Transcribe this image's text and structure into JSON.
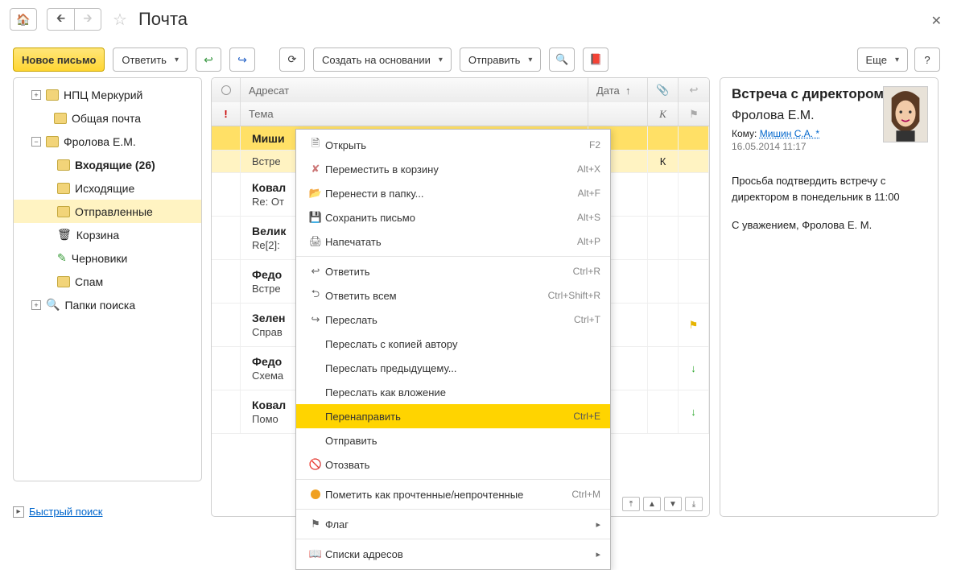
{
  "titlebar": {
    "title": "Почта"
  },
  "toolbar": {
    "new_mail": "Новое письмо",
    "reply": "Ответить",
    "create_based": "Создать на основании",
    "send": "Отправить",
    "more": "Еще"
  },
  "tree": {
    "root1": "НПЦ Меркурий",
    "root2": "Общая почта",
    "root3": "Фролова Е.М.",
    "inbox": "Входящие (26)",
    "outbox": "Исходящие",
    "sent": "Отправленные",
    "trash": "Корзина",
    "drafts": "Черновики",
    "spam": "Спам",
    "search_folders": "Папки поиска",
    "quick_search": "Быстрый поиск"
  },
  "list_header": {
    "addressee": "Адресат",
    "subject": "Тема",
    "date": "Дата",
    "k": "К"
  },
  "messages": [
    {
      "from": "Миши",
      "subj": "Встре",
      "k": "К"
    },
    {
      "from": "Ковал",
      "subj": "Re: От"
    },
    {
      "from": "Велик",
      "subj": "Re[2]:"
    },
    {
      "from": "Федо",
      "subj": "Встре"
    },
    {
      "from": "Зелен",
      "subj": "Справ",
      "flag": "yellow"
    },
    {
      "from": "Федо",
      "subj": "Схема",
      "flag": "green-down"
    },
    {
      "from": "Ковал",
      "subj": "Помо",
      "flag": "green-down"
    }
  ],
  "context_menu": {
    "open": {
      "label": "Открыть",
      "shortcut": "F2"
    },
    "to_trash": {
      "label": "Переместить в корзину",
      "shortcut": "Alt+X"
    },
    "move_to": {
      "label": "Перенести в папку...",
      "shortcut": "Alt+F"
    },
    "save": {
      "label": "Сохранить письмо",
      "shortcut": "Alt+S"
    },
    "print": {
      "label": "Напечатать",
      "shortcut": "Alt+P"
    },
    "reply": {
      "label": "Ответить",
      "shortcut": "Ctrl+R"
    },
    "reply_all": {
      "label": "Ответить всем",
      "shortcut": "Ctrl+Shift+R"
    },
    "forward": {
      "label": "Переслать",
      "shortcut": "Ctrl+T"
    },
    "forward_cc": {
      "label": "Переслать с копией автору"
    },
    "forward_prev": {
      "label": "Переслать предыдущему..."
    },
    "forward_attach": {
      "label": "Переслать как вложение"
    },
    "redirect": {
      "label": "Перенаправить",
      "shortcut": "Ctrl+E"
    },
    "send": {
      "label": "Отправить"
    },
    "recall": {
      "label": "Отозвать"
    },
    "mark_read": {
      "label": "Пометить как прочтенные/непрочтенные",
      "shortcut": "Ctrl+M"
    },
    "flag": {
      "label": "Флаг"
    },
    "addr_lists": {
      "label": "Списки адресов"
    }
  },
  "preview": {
    "title": "Встреча с директором",
    "from": "Фролова Е.М.",
    "to_label": "Кому:",
    "to_name": "Мишин С.А. *",
    "date": "16.05.2014 11:17",
    "body1": "Просьба подтвердить встречу с директором в понедельник в 11:00",
    "body2": "С уважением, Фролова Е. М."
  }
}
